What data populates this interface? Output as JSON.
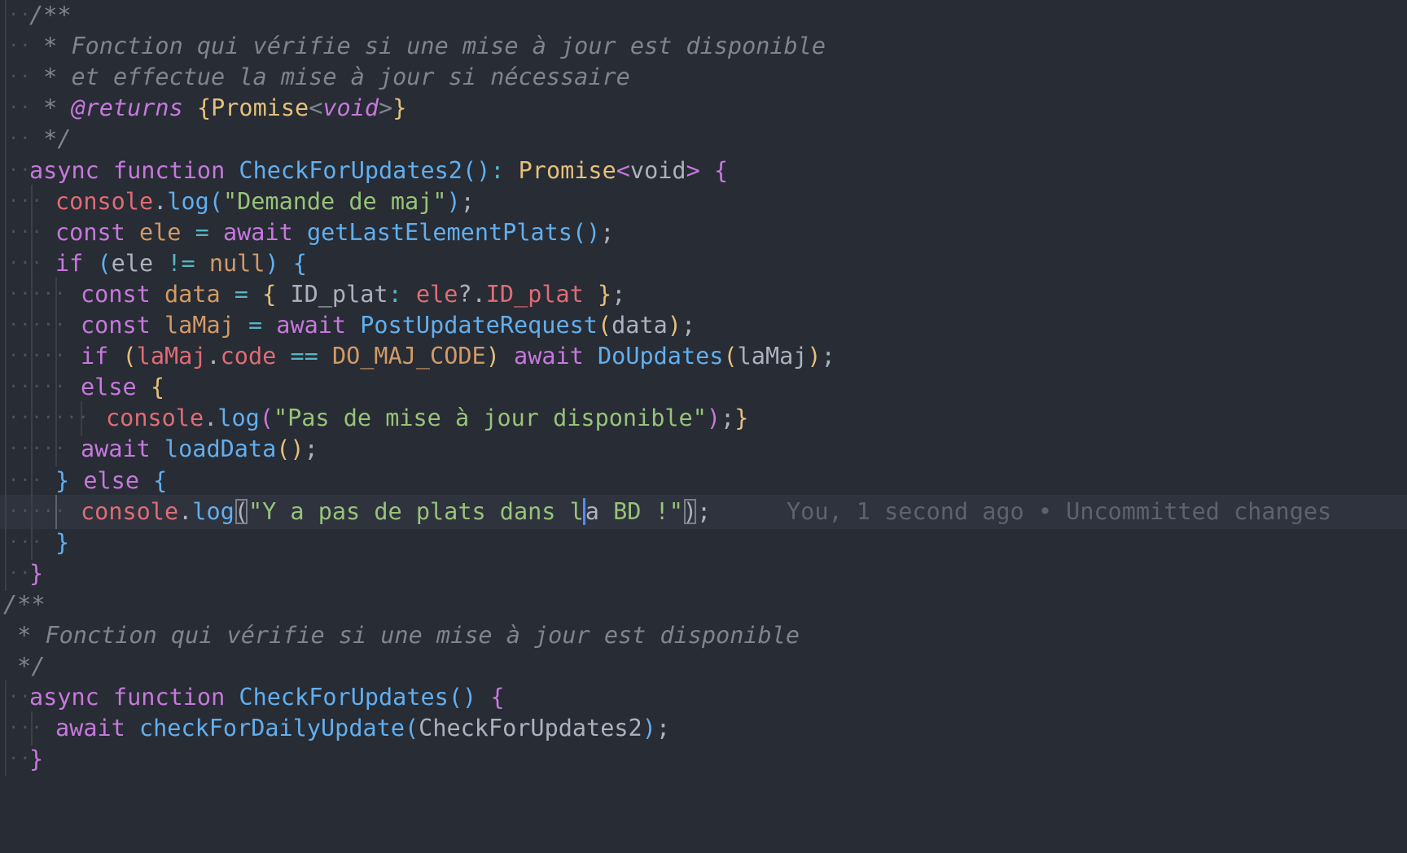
{
  "editor": {
    "language": "typescript",
    "theme_colors": {
      "background": "#282c34",
      "current_line": "#2f333d",
      "keyword": "#c678dd",
      "function": "#61afef",
      "string": "#98c379",
      "variable": "#e06c75",
      "constant": "#d19a66",
      "type": "#e5c07b",
      "comment": "#7f848e",
      "whitespace_marker": "#4b5263",
      "cursor": "#528bff"
    },
    "cursor": {
      "line": 17,
      "char_before_cursor": "l",
      "char_after_cursor": "a"
    },
    "blame_annotation": {
      "line": 17,
      "text": "You, 1 second ago • Uncommitted changes"
    },
    "lines": [
      {
        "ws": "··",
        "indent": 1,
        "tokens": [
          [
            "comment",
            "/**"
          ]
        ]
      },
      {
        "ws": "··",
        "indent": 1,
        "tokens": [
          [
            "comment",
            " * Fonction qui vérifie si une mise à jour est disponible"
          ]
        ]
      },
      {
        "ws": "··",
        "indent": 1,
        "tokens": [
          [
            "comment",
            " * et effectue la mise à jour si nécessaire"
          ]
        ]
      },
      {
        "ws": "··",
        "indent": 1,
        "tokens": [
          [
            "comment",
            " * "
          ],
          [
            "docTag",
            "@returns"
          ],
          [
            "comment",
            " "
          ],
          [
            "bracket1",
            "{"
          ],
          [
            "type",
            "Promise"
          ],
          [
            "comment",
            "<"
          ],
          [
            "docTag",
            "void"
          ],
          [
            "comment",
            ">"
          ],
          [
            "bracket1",
            "}"
          ]
        ]
      },
      {
        "ws": "··",
        "indent": 1,
        "tokens": [
          [
            "comment",
            " */"
          ]
        ]
      },
      {
        "ws": "··",
        "indent": 1,
        "tokens": [
          [
            "keyword",
            "async"
          ],
          [
            "plain",
            " "
          ],
          [
            "keyword",
            "function"
          ],
          [
            "plain",
            " "
          ],
          [
            "function",
            "CheckForUpdates2"
          ],
          [
            "bracket3",
            "()"
          ],
          [
            "operator",
            ":"
          ],
          [
            "plain",
            " "
          ],
          [
            "type",
            "Promise"
          ],
          [
            "bracket2",
            "<"
          ],
          [
            "plain",
            "void"
          ],
          [
            "bracket2",
            ">"
          ],
          [
            "plain",
            " "
          ],
          [
            "bracket2",
            "{"
          ]
        ]
      },
      {
        "ws": "···",
        "indent": 2,
        "tokens": [
          [
            "variable",
            "console"
          ],
          [
            "punct",
            "."
          ],
          [
            "function",
            "log"
          ],
          [
            "bracket3",
            "("
          ],
          [
            "string",
            "\"Demande de maj\""
          ],
          [
            "bracket3",
            ")"
          ],
          [
            "punct",
            ";"
          ]
        ]
      },
      {
        "ws": "···",
        "indent": 2,
        "tokens": [
          [
            "keyword",
            "const"
          ],
          [
            "plain",
            " "
          ],
          [
            "constant",
            "ele"
          ],
          [
            "plain",
            " "
          ],
          [
            "operator",
            "="
          ],
          [
            "plain",
            " "
          ],
          [
            "keyword",
            "await"
          ],
          [
            "plain",
            " "
          ],
          [
            "function",
            "getLastElementPlats"
          ],
          [
            "bracket3",
            "()"
          ],
          [
            "punct",
            ";"
          ]
        ]
      },
      {
        "ws": "···",
        "indent": 2,
        "tokens": [
          [
            "keyword",
            "if"
          ],
          [
            "plain",
            " "
          ],
          [
            "bracket3",
            "("
          ],
          [
            "plain",
            "ele "
          ],
          [
            "operator",
            "!="
          ],
          [
            "plain",
            " "
          ],
          [
            "constant",
            "null"
          ],
          [
            "bracket3",
            ")"
          ],
          [
            "plain",
            " "
          ],
          [
            "bracket3",
            "{"
          ]
        ]
      },
      {
        "ws": "·····",
        "indent": 3,
        "tokens": [
          [
            "keyword",
            "const"
          ],
          [
            "plain",
            " "
          ],
          [
            "constant",
            "data"
          ],
          [
            "plain",
            " "
          ],
          [
            "operator",
            "="
          ],
          [
            "plain",
            " "
          ],
          [
            "bracket1",
            "{"
          ],
          [
            "plain",
            " ID_plat"
          ],
          [
            "operator",
            ":"
          ],
          [
            "plain",
            " "
          ],
          [
            "variable",
            "ele"
          ],
          [
            "punct",
            "?."
          ],
          [
            "variable",
            "ID_plat"
          ],
          [
            "plain",
            " "
          ],
          [
            "bracket1",
            "}"
          ],
          [
            "punct",
            ";"
          ]
        ]
      },
      {
        "ws": "·····",
        "indent": 3,
        "tokens": [
          [
            "keyword",
            "const"
          ],
          [
            "plain",
            " "
          ],
          [
            "constant",
            "laMaj"
          ],
          [
            "plain",
            " "
          ],
          [
            "operator",
            "="
          ],
          [
            "plain",
            " "
          ],
          [
            "keyword",
            "await"
          ],
          [
            "plain",
            " "
          ],
          [
            "function",
            "PostUpdateRequest"
          ],
          [
            "bracket1",
            "("
          ],
          [
            "plain",
            "data"
          ],
          [
            "bracket1",
            ")"
          ],
          [
            "punct",
            ";"
          ]
        ]
      },
      {
        "ws": "·····",
        "indent": 3,
        "tokens": [
          [
            "keyword",
            "if"
          ],
          [
            "plain",
            " "
          ],
          [
            "bracket1",
            "("
          ],
          [
            "variable",
            "laMaj"
          ],
          [
            "punct",
            "."
          ],
          [
            "variable",
            "code"
          ],
          [
            "plain",
            " "
          ],
          [
            "operator",
            "=="
          ],
          [
            "plain",
            " "
          ],
          [
            "constant",
            "DO_MAJ_CODE"
          ],
          [
            "bracket1",
            ")"
          ],
          [
            "plain",
            " "
          ],
          [
            "keyword",
            "await"
          ],
          [
            "plain",
            " "
          ],
          [
            "function",
            "DoUpdates"
          ],
          [
            "bracket1",
            "("
          ],
          [
            "plain",
            "laMaj"
          ],
          [
            "bracket1",
            ")"
          ],
          [
            "punct",
            ";"
          ]
        ]
      },
      {
        "ws": "·····",
        "indent": 3,
        "tokens": [
          [
            "keyword",
            "else"
          ],
          [
            "plain",
            " "
          ],
          [
            "bracket1",
            "{"
          ]
        ]
      },
      {
        "ws": "·······",
        "indent": 4,
        "tokens": [
          [
            "variable",
            "console"
          ],
          [
            "punct",
            "."
          ],
          [
            "function",
            "log"
          ],
          [
            "bracket2",
            "("
          ],
          [
            "string",
            "\"Pas de mise à jour disponible\""
          ],
          [
            "bracket2",
            ")"
          ],
          [
            "punct",
            ";"
          ],
          [
            "bracket1",
            "}"
          ]
        ]
      },
      {
        "ws": "·····",
        "indent": 3,
        "tokens": [
          [
            "keyword",
            "await"
          ],
          [
            "plain",
            " "
          ],
          [
            "function",
            "loadData"
          ],
          [
            "bracket1",
            "()"
          ],
          [
            "punct",
            ";"
          ]
        ]
      },
      {
        "ws": "···",
        "indent": 2,
        "tokens": [
          [
            "bracket3",
            "}"
          ],
          [
            "plain",
            " "
          ],
          [
            "keyword",
            "else"
          ],
          [
            "plain",
            " "
          ],
          [
            "bracket3",
            "{"
          ]
        ]
      },
      {
        "ws": "·····",
        "indent": 3,
        "current": true,
        "tokens": [
          [
            "variable",
            "console"
          ],
          [
            "punct",
            "."
          ],
          [
            "function",
            "log"
          ],
          [
            "bracketHl",
            "("
          ],
          [
            "string",
            "\"Y a pas de plats dans l"
          ],
          [
            "cursor",
            "a"
          ],
          [
            "string",
            " BD !\""
          ],
          [
            "bracketHl",
            ")"
          ],
          [
            "punct",
            ";"
          ]
        ]
      },
      {
        "ws": "···",
        "indent": 2,
        "tokens": [
          [
            "bracket3",
            "}"
          ]
        ]
      },
      {
        "ws": "··",
        "indent": 1,
        "tokens": [
          [
            "bracket2",
            "}"
          ]
        ]
      },
      {
        "ws": "",
        "indent": 0,
        "tokens": [
          [
            "comment",
            "/**"
          ]
        ]
      },
      {
        "ws": "",
        "indent": 0,
        "tokens": [
          [
            "comment",
            " * Fonction qui vérifie si une mise à jour est disponible"
          ]
        ]
      },
      {
        "ws": "",
        "indent": 0,
        "tokens": [
          [
            "comment",
            " */"
          ]
        ]
      },
      {
        "ws": "··",
        "indent": 1,
        "tokens": [
          [
            "keyword",
            "async"
          ],
          [
            "plain",
            " "
          ],
          [
            "keyword",
            "function"
          ],
          [
            "plain",
            " "
          ],
          [
            "function",
            "CheckForUpdates"
          ],
          [
            "bracket3",
            "()"
          ],
          [
            "plain",
            " "
          ],
          [
            "bracket2",
            "{"
          ]
        ]
      },
      {
        "ws": "···",
        "indent": 2,
        "tokens": [
          [
            "keyword",
            "await"
          ],
          [
            "plain",
            " "
          ],
          [
            "function",
            "checkForDailyUpdate"
          ],
          [
            "bracket3",
            "("
          ],
          [
            "plain",
            "CheckForUpdates2"
          ],
          [
            "bracket3",
            ")"
          ],
          [
            "punct",
            ";"
          ]
        ]
      },
      {
        "ws": "··",
        "indent": 1,
        "tokens": [
          [
            "bracket2",
            "}"
          ]
        ]
      }
    ]
  }
}
